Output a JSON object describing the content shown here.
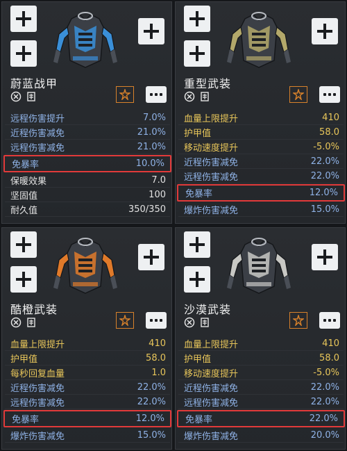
{
  "colors": {
    "accent_red": "#e23a3a",
    "stat_blue": "#8fb2e6",
    "stat_gold": "#e8c65a",
    "badge_orange": "#d9822b"
  },
  "cards": [
    {
      "name": "蔚蓝战甲",
      "armor_color": "#3a8fd8",
      "stats": [
        {
          "label": "远程伤害提升",
          "value": "7.0%",
          "tone": "blue"
        },
        {
          "label": "近程伤害减免",
          "value": "21.0%",
          "tone": "blue"
        },
        {
          "label": "远程伤害减免",
          "value": "21.0%",
          "tone": "blue"
        },
        {
          "label": "免暴率",
          "value": "10.0%",
          "tone": "blue",
          "highlight": true
        },
        {
          "label": "保暖效果",
          "value": "7.0",
          "tone": "white"
        },
        {
          "label": "坚固值",
          "value": "100",
          "tone": "white"
        },
        {
          "label": "耐久值",
          "value": "350/350",
          "tone": "white"
        }
      ]
    },
    {
      "name": "重型武装",
      "armor_color": "#b3a86a",
      "stats": [
        {
          "label": "血量上限提升",
          "value": "410",
          "tone": "gold"
        },
        {
          "label": "护甲值",
          "value": "58.0",
          "tone": "gold"
        },
        {
          "label": "移动速度提升",
          "value": "-5.0%",
          "tone": "gold"
        },
        {
          "label": "近程伤害减免",
          "value": "22.0%",
          "tone": "blue"
        },
        {
          "label": "远程伤害减免",
          "value": "22.0%",
          "tone": "blue"
        },
        {
          "label": "免暴率",
          "value": "12.0%",
          "tone": "blue",
          "highlight": true
        },
        {
          "label": "爆炸伤害减免",
          "value": "15.0%",
          "tone": "blue"
        }
      ]
    },
    {
      "name": "酷橙武装",
      "armor_color": "#e07a2a",
      "stats": [
        {
          "label": "血量上限提升",
          "value": "410",
          "tone": "gold"
        },
        {
          "label": "护甲值",
          "value": "58.0",
          "tone": "gold"
        },
        {
          "label": "每秒回复血量",
          "value": "1.0",
          "tone": "gold"
        },
        {
          "label": "近程伤害减免",
          "value": "22.0%",
          "tone": "blue"
        },
        {
          "label": "远程伤害减免",
          "value": "22.0%",
          "tone": "blue"
        },
        {
          "label": "免暴率",
          "value": "12.0%",
          "tone": "blue",
          "highlight": true
        },
        {
          "label": "爆炸伤害减免",
          "value": "15.0%",
          "tone": "blue"
        }
      ]
    },
    {
      "name": "沙漠武装",
      "armor_color": "#c8c8c4",
      "stats": [
        {
          "label": "血量上限提升",
          "value": "410",
          "tone": "gold"
        },
        {
          "label": "护甲值",
          "value": "58.0",
          "tone": "gold"
        },
        {
          "label": "移动速度提升",
          "value": "-5.0%",
          "tone": "gold"
        },
        {
          "label": "近程伤害减免",
          "value": "22.0%",
          "tone": "blue"
        },
        {
          "label": "远程伤害减免",
          "value": "22.0%",
          "tone": "blue"
        },
        {
          "label": "免暴率",
          "value": "22.0%",
          "tone": "blue",
          "highlight": true
        },
        {
          "label": "爆炸伤害减免",
          "value": "20.0%",
          "tone": "blue"
        }
      ]
    }
  ]
}
